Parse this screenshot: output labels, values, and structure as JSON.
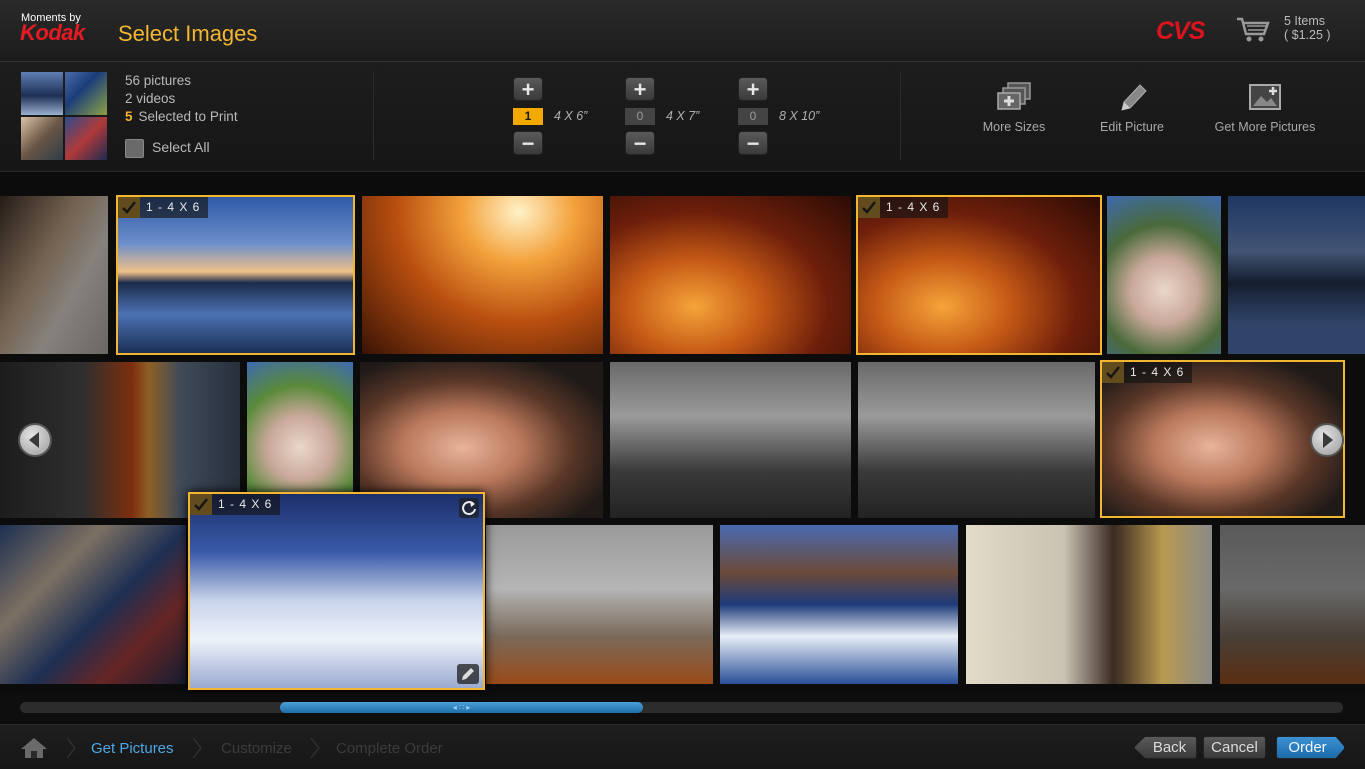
{
  "header": {
    "brand_small": "Moments by",
    "brand_name": "Kodak",
    "title": "Select Images",
    "store_logo": "CVS",
    "cart_icon": "cart-icon",
    "cart_items": "5 Items",
    "cart_total": "( $1.25 )"
  },
  "toolbar": {
    "pictures": "56 pictures",
    "videos": "2 videos",
    "selected_count": "5",
    "selected_label": "Selected to Print",
    "select_all": "Select All",
    "sizes": [
      {
        "label": "4 X 6”",
        "count": "1",
        "plus": "+",
        "minus": "−"
      },
      {
        "label": "4 X 7”",
        "count": "0",
        "plus": "+",
        "minus": "−"
      },
      {
        "label": "8 X 10”",
        "count": "0",
        "plus": "+",
        "minus": "−"
      }
    ],
    "tools": [
      {
        "label": "More Sizes",
        "icon": "more-sizes-icon"
      },
      {
        "label": "Edit Picture",
        "icon": "pencil-icon"
      },
      {
        "label": "Get More Pictures",
        "icon": "add-picture-icon"
      }
    ]
  },
  "grid": {
    "photos": [
      {
        "subject": "child-at-computer",
        "selected": false
      },
      {
        "subject": "lake-sunset",
        "selected": true,
        "tag": "1 - 4 X 6"
      },
      {
        "subject": "desert-road",
        "selected": false
      },
      {
        "subject": "canyon",
        "selected": false
      },
      {
        "subject": "canyon",
        "selected": true,
        "tag": "1 - 4 X 6"
      },
      {
        "subject": "cow",
        "selected": false
      },
      {
        "subject": "lake-sunset",
        "selected": false
      },
      {
        "subject": "firefighter",
        "selected": false
      },
      {
        "subject": "cow",
        "selected": false
      },
      {
        "subject": "crying-baby",
        "selected": false
      },
      {
        "subject": "cyclists",
        "selected": false
      },
      {
        "subject": "cyclists",
        "selected": false
      },
      {
        "subject": "crying-baby",
        "selected": true,
        "tag": "1 - 4 X 6"
      },
      {
        "subject": "softball-team",
        "selected": false
      },
      {
        "subject": "snowy-orchard",
        "selected": true,
        "tag": "1 - 4 X 6"
      },
      {
        "subject": "foggy-tree",
        "selected": false
      },
      {
        "subject": "surfer",
        "selected": false
      },
      {
        "subject": "man-reading-newspaper",
        "selected": false
      },
      {
        "subject": "foggy-tree",
        "selected": false
      }
    ]
  },
  "scrollbar": {
    "grip": "◂ ∷ ▸"
  },
  "footer": {
    "steps": [
      "Get Pictures",
      "Customize",
      "Complete Order"
    ],
    "back": "Back",
    "cancel": "Cancel",
    "order": "Order"
  },
  "colors": {
    "accent": "#f2b630",
    "brand_red": "#e41b23",
    "link_blue": "#4fa8e6",
    "order_blue": "#1c6aa8"
  }
}
